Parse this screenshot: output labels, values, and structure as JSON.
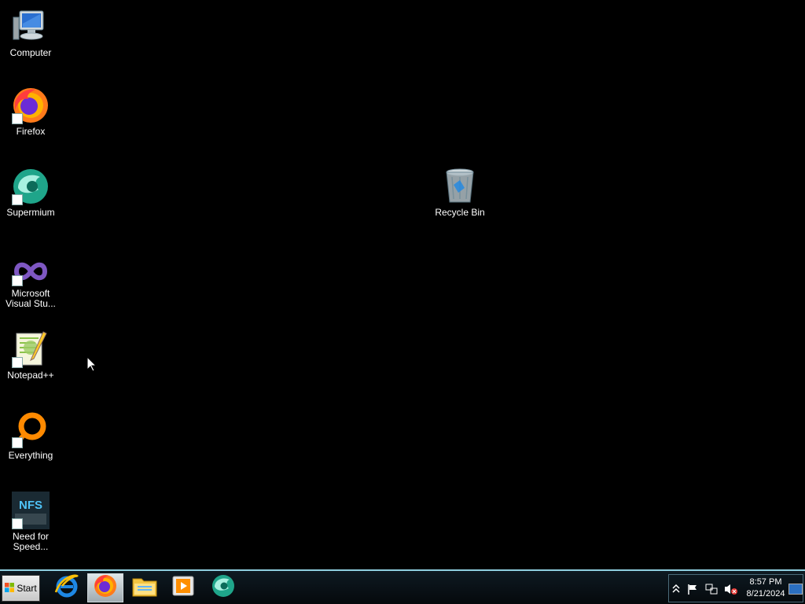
{
  "desktop": {
    "icons": [
      {
        "label": "Computer",
        "icon": "computer-icon"
      },
      {
        "label": "Firefox",
        "icon": "firefox-icon"
      },
      {
        "label": "Supermium",
        "icon": "supermium-icon"
      },
      {
        "label": "Microsoft Visual Stu...",
        "icon": "visual-studio-icon"
      },
      {
        "label": "Notepad++",
        "icon": "notepad-plus-plus-icon"
      },
      {
        "label": "Everything",
        "icon": "everything-icon"
      },
      {
        "label": "Need for Speed...",
        "icon": "need-for-speed-icon"
      },
      {
        "label": "Recycle Bin",
        "icon": "recycle-bin-icon"
      }
    ],
    "background_color": "#000000"
  },
  "taskbar": {
    "start_label": "Start",
    "apps": [
      {
        "icon": "internet-explorer-icon",
        "active": false
      },
      {
        "icon": "firefox-icon",
        "active": true
      },
      {
        "icon": "file-explorer-icon",
        "active": false
      },
      {
        "icon": "media-player-icon",
        "active": false
      },
      {
        "icon": "supermium-icon",
        "active": false
      }
    ],
    "tray": {
      "icons": [
        "show-hidden-icons-icon",
        "action-center-flag-icon",
        "network-icon",
        "volume-muted-icon"
      ],
      "time": "8:57 PM",
      "date": "8/21/2024"
    }
  }
}
